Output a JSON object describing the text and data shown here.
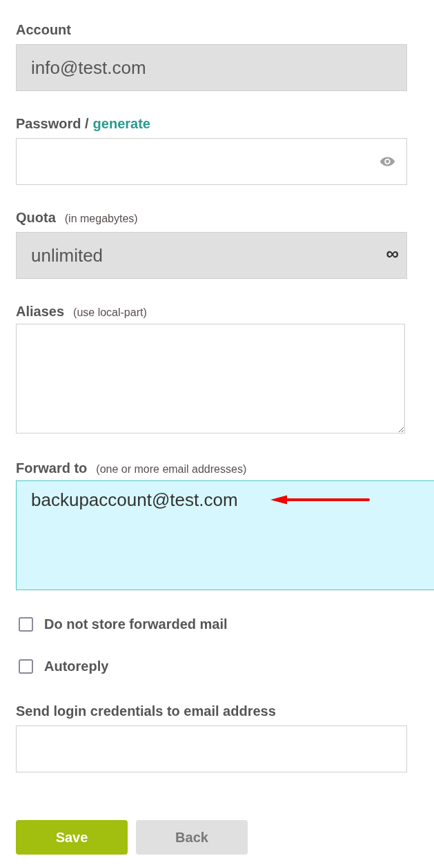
{
  "fields": [
    {
      "kind": "text",
      "label": "Account",
      "value": "info@test.com",
      "disabled": true,
      "focused": false
    },
    {
      "kind": "password",
      "label": "Password /",
      "link": "generate",
      "disabled": false,
      "focused": false
    },
    {
      "kind": "text",
      "label": "Quota",
      "hint": "(in megabytes)",
      "value": "unlimited",
      "suffix": "∞",
      "disabled": true,
      "focused": false
    },
    {
      "kind": "textarea",
      "label": "Aliases",
      "hint": "(use local-part)",
      "disabled": false,
      "focused": false,
      "resizable": true
    },
    {
      "kind": "textarea",
      "label": "Forward to",
      "hint": "(one or more email addresses)",
      "value": "backupaccount@test.com",
      "disabled": false,
      "focused": true,
      "resizable": false,
      "annotated": true
    }
  ],
  "checkboxes": [
    {
      "label": "Do not store forwarded mail",
      "checked": false
    },
    {
      "label": "Autoreply",
      "checked": false
    }
  ],
  "credentials": {
    "label": "Send login credentials to email address"
  },
  "buttons": [
    {
      "label": "Save",
      "kind": "primary"
    },
    {
      "label": "Back",
      "kind": "secondary"
    }
  ]
}
